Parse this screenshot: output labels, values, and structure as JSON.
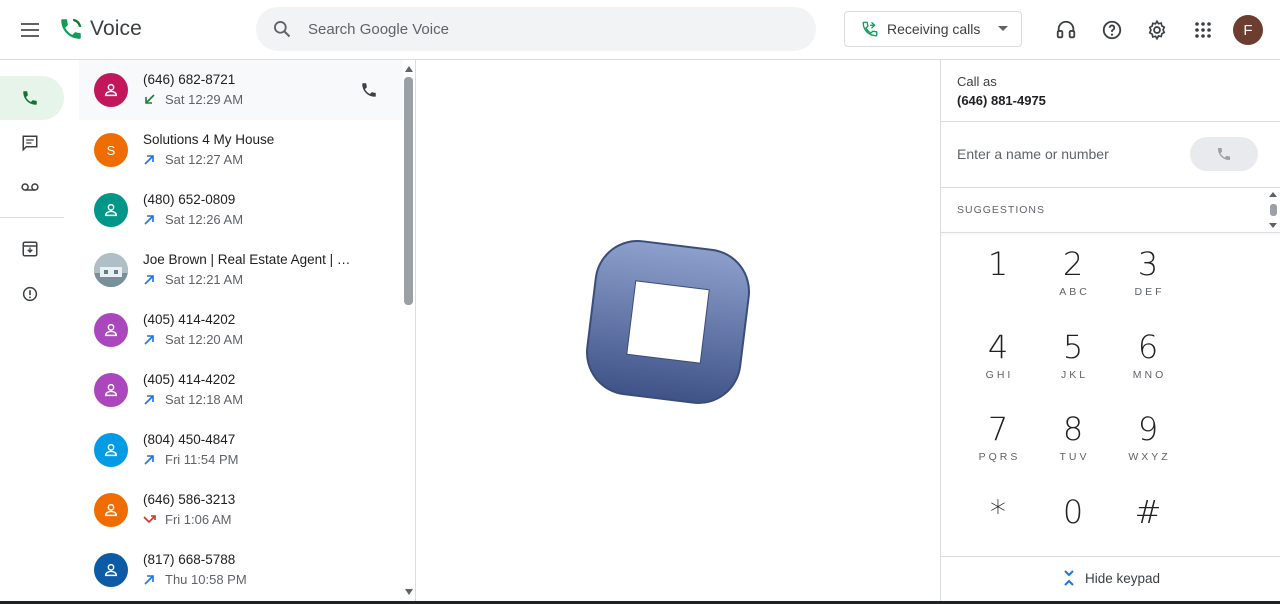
{
  "app": {
    "name": "Voice",
    "brand_color": "#0f9d58"
  },
  "search": {
    "placeholder": "Search Google Voice"
  },
  "status": {
    "label": "Receiving calls",
    "color": "#0f9d58"
  },
  "account": {
    "initial": "F",
    "avatar_color": "#6d3d2f"
  },
  "nav": [
    {
      "name": "calls",
      "icon": "phone-icon",
      "active": true
    },
    {
      "name": "messages",
      "icon": "message-icon",
      "active": false
    },
    {
      "name": "voicemail",
      "icon": "voicemail-icon",
      "active": false
    },
    {
      "name": "archive",
      "icon": "archive-icon",
      "active": false
    },
    {
      "name": "spam",
      "icon": "spam-icon",
      "active": false
    }
  ],
  "calls": [
    {
      "name": "(646) 682-8721",
      "time": "Sat 12:29 AM",
      "direction": "incoming",
      "avatar_color": "#c2185b",
      "initial": "",
      "selected": true
    },
    {
      "name": "Solutions 4 My House",
      "time": "Sat 12:27 AM",
      "direction": "outgoing",
      "avatar_color": "#ef6c00",
      "initial": "S",
      "selected": false
    },
    {
      "name": "(480) 652-0809",
      "time": "Sat 12:26 AM",
      "direction": "outgoing",
      "avatar_color": "#009688",
      "initial": "",
      "selected": false
    },
    {
      "name": "Joe Brown | Real Estate Agent | …",
      "time": "Sat 12:21 AM",
      "direction": "outgoing",
      "avatar_color": "#90a4ae",
      "initial": "",
      "selected": false
    },
    {
      "name": "(405) 414-4202",
      "time": "Sat 12:20 AM",
      "direction": "outgoing",
      "avatar_color": "#ab47bc",
      "initial": "",
      "selected": false
    },
    {
      "name": "(405) 414-4202",
      "time": "Sat 12:18 AM",
      "direction": "outgoing",
      "avatar_color": "#ab47bc",
      "initial": "",
      "selected": false
    },
    {
      "name": "(804) 450-4847",
      "time": "Fri 11:54 PM",
      "direction": "outgoing",
      "avatar_color": "#039be5",
      "initial": "",
      "selected": false
    },
    {
      "name": "(646) 586-3213",
      "time": "Fri 1:06 AM",
      "direction": "missed",
      "avatar_color": "#ef6c00",
      "initial": "",
      "selected": false
    },
    {
      "name": "(817) 668-5788",
      "time": "Thu 10:58 PM",
      "direction": "outgoing",
      "avatar_color": "#0d5ba6",
      "initial": "",
      "selected": false
    }
  ],
  "dialer": {
    "call_as_label": "Call as",
    "call_as_number": "(646) 881-4975",
    "input_placeholder": "Enter a name or number",
    "suggestions_label": "SUGGESTIONS",
    "keys": [
      {
        "digit": "1",
        "letters": ""
      },
      {
        "digit": "2",
        "letters": "ABC"
      },
      {
        "digit": "3",
        "letters": "DEF"
      },
      {
        "digit": "4",
        "letters": "GHI"
      },
      {
        "digit": "5",
        "letters": "JKL"
      },
      {
        "digit": "6",
        "letters": "MNO"
      },
      {
        "digit": "7",
        "letters": "PQRS"
      },
      {
        "digit": "8",
        "letters": "TUV"
      },
      {
        "digit": "9",
        "letters": "WXYZ"
      },
      {
        "digit": "*",
        "letters": ""
      },
      {
        "digit": "0",
        "letters": ""
      },
      {
        "digit": "#",
        "letters": ""
      }
    ],
    "hide_keypad_label": "Hide keypad"
  },
  "overlay_icon": "stop-icon"
}
